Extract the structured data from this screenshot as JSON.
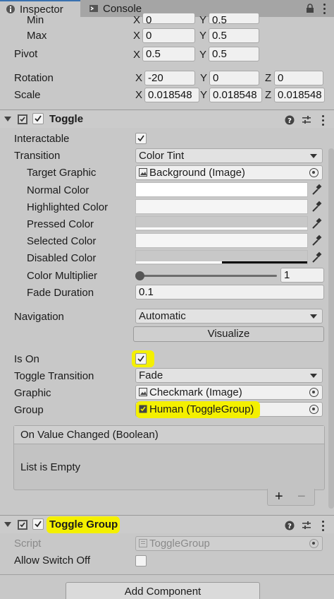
{
  "tabs": [
    {
      "label": "Inspector",
      "icon": "info-icon",
      "active": true
    },
    {
      "label": "Console",
      "icon": "console-icon",
      "active": false
    }
  ],
  "rect_transform": {
    "min": {
      "label": "Min",
      "x": "0",
      "y": "0.5"
    },
    "max": {
      "label": "Max",
      "x": "0",
      "y": "0.5"
    },
    "pivot": {
      "label": "Pivot",
      "x": "0.5",
      "y": "0.5"
    },
    "rotation": {
      "label": "Rotation",
      "x": "-20",
      "y": "0",
      "z": "0"
    },
    "scale": {
      "label": "Scale",
      "x": "0.018548",
      "y": "0.018548",
      "z": "0.018548"
    },
    "axis": {
      "x": "X",
      "y": "Y",
      "z": "Z"
    }
  },
  "toggle": {
    "title": "Toggle",
    "interactable_label": "Interactable",
    "interactable": true,
    "transition_label": "Transition",
    "transition": "Color Tint",
    "target_graphic_label": "Target Graphic",
    "target_graphic": "Background (Image)",
    "normal_color_label": "Normal Color",
    "highlighted_color_label": "Highlighted Color",
    "pressed_color_label": "Pressed Color",
    "selected_color_label": "Selected Color",
    "disabled_color_label": "Disabled Color",
    "color_multiplier_label": "Color Multiplier",
    "color_multiplier": "1",
    "color_multiplier_slider_fraction": 0.0,
    "fade_duration_label": "Fade Duration",
    "fade_duration": "0.1",
    "navigation_label": "Navigation",
    "navigation": "Automatic",
    "visualize_label": "Visualize",
    "is_on_label": "Is On",
    "is_on": true,
    "toggle_transition_label": "Toggle Transition",
    "toggle_transition": "Fade",
    "graphic_label": "Graphic",
    "graphic": "Checkmark (Image)",
    "group_label": "Group",
    "group": "Human (ToggleGroup)",
    "event_title": "On Value Changed (Boolean)",
    "event_empty": "List is Empty",
    "event_add": "+",
    "event_remove": "−",
    "colors": {
      "normal": "#ffffff",
      "highlighted": "#f5f5f5",
      "pressed": "#c8c8c8",
      "selected": "#f5f5f5",
      "disabled": "#c8c8c8"
    }
  },
  "toggle_group": {
    "title": "Toggle Group",
    "script_label": "Script",
    "script": "ToggleGroup",
    "allow_switch_off_label": "Allow Switch Off",
    "allow_switch_off": false
  },
  "add_component_label": "Add Component",
  "highlight_color": "#f4f000",
  "accent": "#3a72b0"
}
